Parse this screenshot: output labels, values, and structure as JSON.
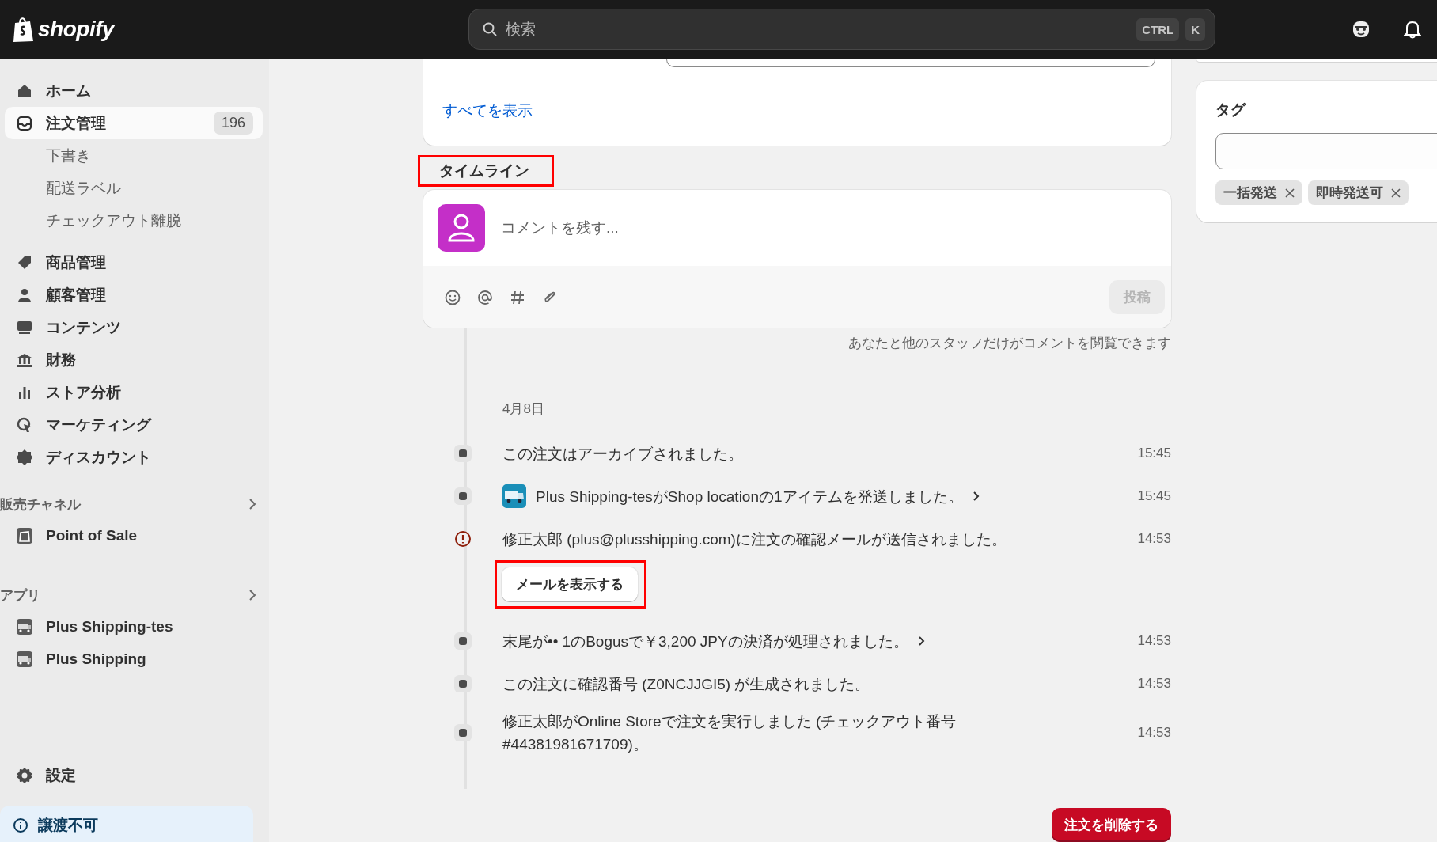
{
  "topbar": {
    "logo": "shopify",
    "search": {
      "placeholder": "検索",
      "keys": [
        "CTRL",
        "K"
      ]
    }
  },
  "sidebar": {
    "items": [
      {
        "label": "ホーム",
        "selected": false
      },
      {
        "label": "注文管理",
        "badge": "196",
        "selected": true,
        "children": [
          {
            "label": "下書き",
            "selected": false
          },
          {
            "label": "配送ラベル",
            "selected": false
          },
          {
            "label": "チェックアウト離脱",
            "selected": false
          }
        ]
      },
      {
        "label": "商品管理",
        "selected": false
      },
      {
        "label": "顧客管理",
        "selected": false
      },
      {
        "label": "コンテンツ",
        "selected": false
      },
      {
        "label": "財務",
        "selected": false
      },
      {
        "label": "ストア分析",
        "selected": false
      },
      {
        "label": "マーケティング",
        "selected": false
      },
      {
        "label": "ディスカウント",
        "selected": false
      }
    ],
    "sections": [
      {
        "title": "販売チャネル",
        "items": [
          {
            "label": "Point of Sale",
            "kind": "channel"
          }
        ]
      },
      {
        "title": "アプリ",
        "items": [
          {
            "label": "Plus Shipping-tes",
            "kind": "app"
          },
          {
            "label": "Plus Shipping",
            "kind": "app"
          }
        ]
      }
    ],
    "settings": "設定",
    "notice": "譲渡不可"
  },
  "main": {
    "show_all_link": "すべてを表示",
    "timeline": {
      "title": "タイムライン",
      "highlighted": true,
      "comment": {
        "placeholder": "コメントを残す...",
        "post_button": "投稿",
        "note": "あなたと他のスタッフだけがコメントを閲覧できます"
      },
      "date": "4月8日",
      "events": [
        {
          "text": "この注文はアーカイブされました。",
          "time": "15:45",
          "kind": "dot",
          "app_icon": false,
          "link": false
        },
        {
          "text": "Plus Shipping-tesがShop locationの1アイテムを発送しました。",
          "time": "15:45",
          "kind": "dot",
          "app_icon": true,
          "link": true
        },
        {
          "text": "修正太郎 (plus@plusshipping.com)に注文の確認メールが送信されました。",
          "time": "14:53",
          "kind": "alert",
          "app_icon": false,
          "link": false,
          "button": {
            "label": "メールを表示する",
            "highlighted": true
          }
        },
        {
          "text": "末尾が•• 1のBogusで￥3,200 JPYの決済が処理されました。",
          "time": "14:53",
          "kind": "dot",
          "app_icon": false,
          "link": true
        },
        {
          "text": "この注文に確認番号 (Z0NCJJGI5) が生成されました。",
          "time": "14:53",
          "kind": "dot",
          "app_icon": false,
          "link": false
        },
        {
          "text": "修正太郎がOnline Storeで注文を実行しました (チェックアウト番号 #44381981671709)。",
          "time": "14:53",
          "kind": "dot",
          "app_icon": false,
          "link": false
        }
      ]
    },
    "delete_button": "注文を削除する"
  },
  "tags": {
    "title": "タグ",
    "items": [
      "一括発送",
      "即時発送可"
    ]
  }
}
